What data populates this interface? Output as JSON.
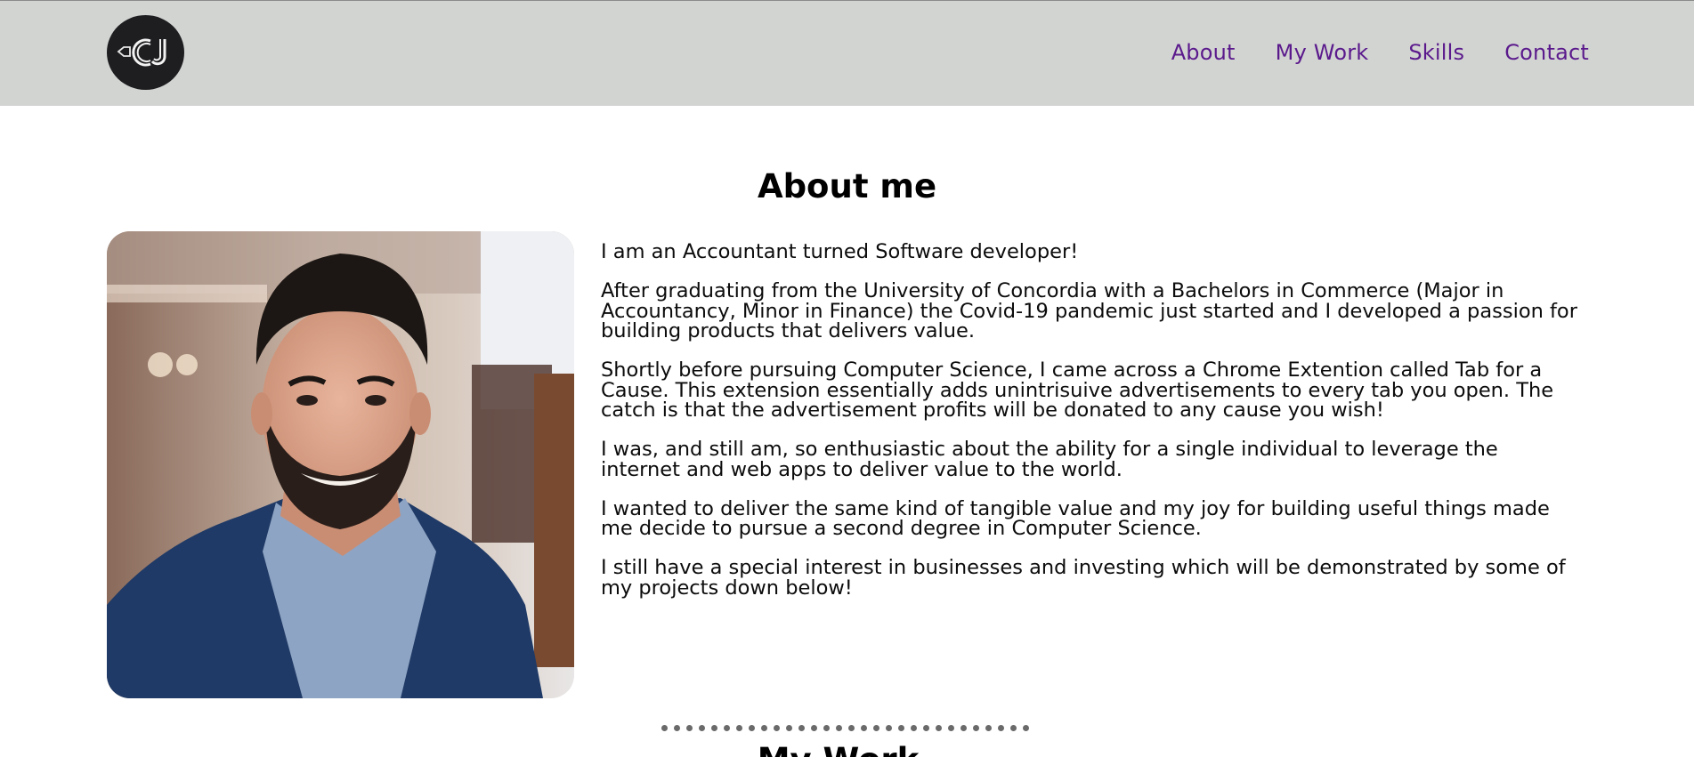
{
  "header": {
    "logo_text": "CJ",
    "nav": [
      {
        "label": "About"
      },
      {
        "label": "My Work"
      },
      {
        "label": "Skills"
      },
      {
        "label": "Contact"
      }
    ]
  },
  "about": {
    "title": "About me",
    "photo_icon": "profile-photo",
    "paragraphs": [
      "I am an Accountant turned Software developer!",
      "After graduating from the University of Concordia with a Bachelors in Commerce (Major in Accountancy, Minor in Finance) the Covid-19 pandemic just started and I developed a passion for building products that delivers value.",
      "Shortly before pursuing Computer Science, I came across a Chrome Extention called Tab for a Cause. This extension essentially adds unintrisuive advertisements to every tab you open. The catch is that the advertisement profits will be donated to any cause you wish!",
      "I was, and still am, so enthusiastic about the ability for a single individual to leverage the internet and web apps to deliver value to the world.",
      "I wanted to deliver the same kind of tangible value and my joy for building useful things made me decide to pursue a second degree in Computer Science.",
      "I still have a special interest in businesses and investing which will be demonstrated by some of my projects down below!"
    ]
  },
  "next_section": {
    "title": "My Work"
  },
  "colors": {
    "header_bg": "#d2d4d2",
    "nav_link": "#5b1a8c",
    "logo_bg": "#1e1e21"
  }
}
